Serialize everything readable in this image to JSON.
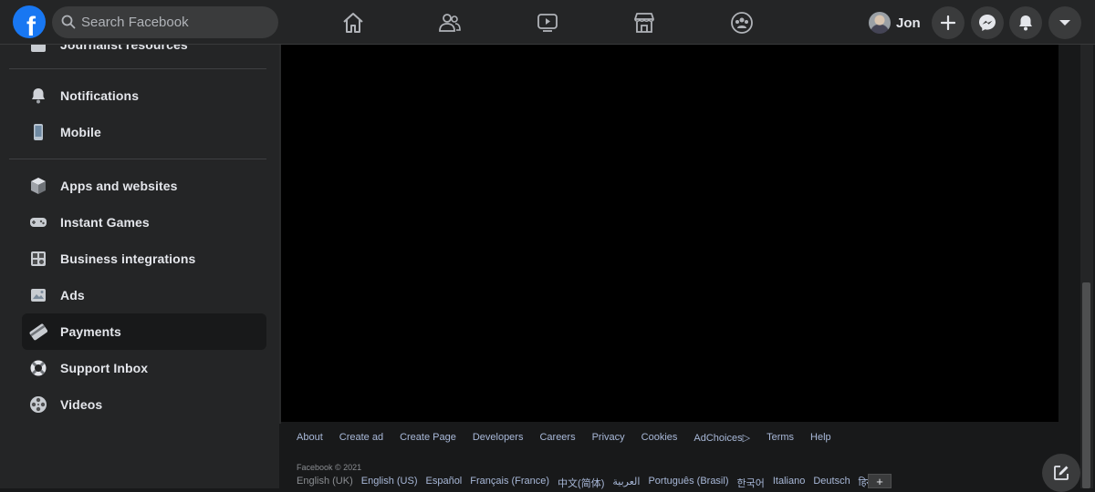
{
  "header": {
    "logo_letter": "f",
    "search_placeholder": "Search Facebook",
    "profile_name": "Jon",
    "icons": [
      "home-icon",
      "friends-icon",
      "watch-icon",
      "marketplace-icon",
      "groups-icon",
      "add-icon",
      "messenger-icon",
      "notifications-icon",
      "account-menu-icon"
    ],
    "accent": "#1877f2"
  },
  "sidebar": {
    "partial_item": "Journalist resources",
    "items": [
      {
        "label": "Notifications",
        "icon": "bell-icon"
      },
      {
        "label": "Mobile",
        "icon": "phone-icon"
      },
      {
        "label": "Apps and websites",
        "icon": "cube-icon"
      },
      {
        "label": "Instant Games",
        "icon": "gamepad-icon"
      },
      {
        "label": "Business integrations",
        "icon": "business-icon"
      },
      {
        "label": "Ads",
        "icon": "ads-icon"
      },
      {
        "label": "Payments",
        "icon": "payment-card-icon",
        "active": true
      },
      {
        "label": "Support Inbox",
        "icon": "lifebuoy-icon"
      },
      {
        "label": "Videos",
        "icon": "film-reel-icon"
      }
    ]
  },
  "footer": {
    "links": [
      "About",
      "Create ad",
      "Create Page",
      "Developers",
      "Careers",
      "Privacy",
      "Cookies",
      "AdChoices",
      "Terms",
      "Help"
    ],
    "adchoices_glyph": "▷",
    "copyright": "Facebook © 2021",
    "languages": [
      "English (UK)",
      "English (US)",
      "Español",
      "Français (France)",
      "中文(简体)",
      "العربية",
      "Português (Brasil)",
      "한국어",
      "Italiano",
      "Deutsch",
      "हिन्दी"
    ],
    "add_language": "+"
  }
}
